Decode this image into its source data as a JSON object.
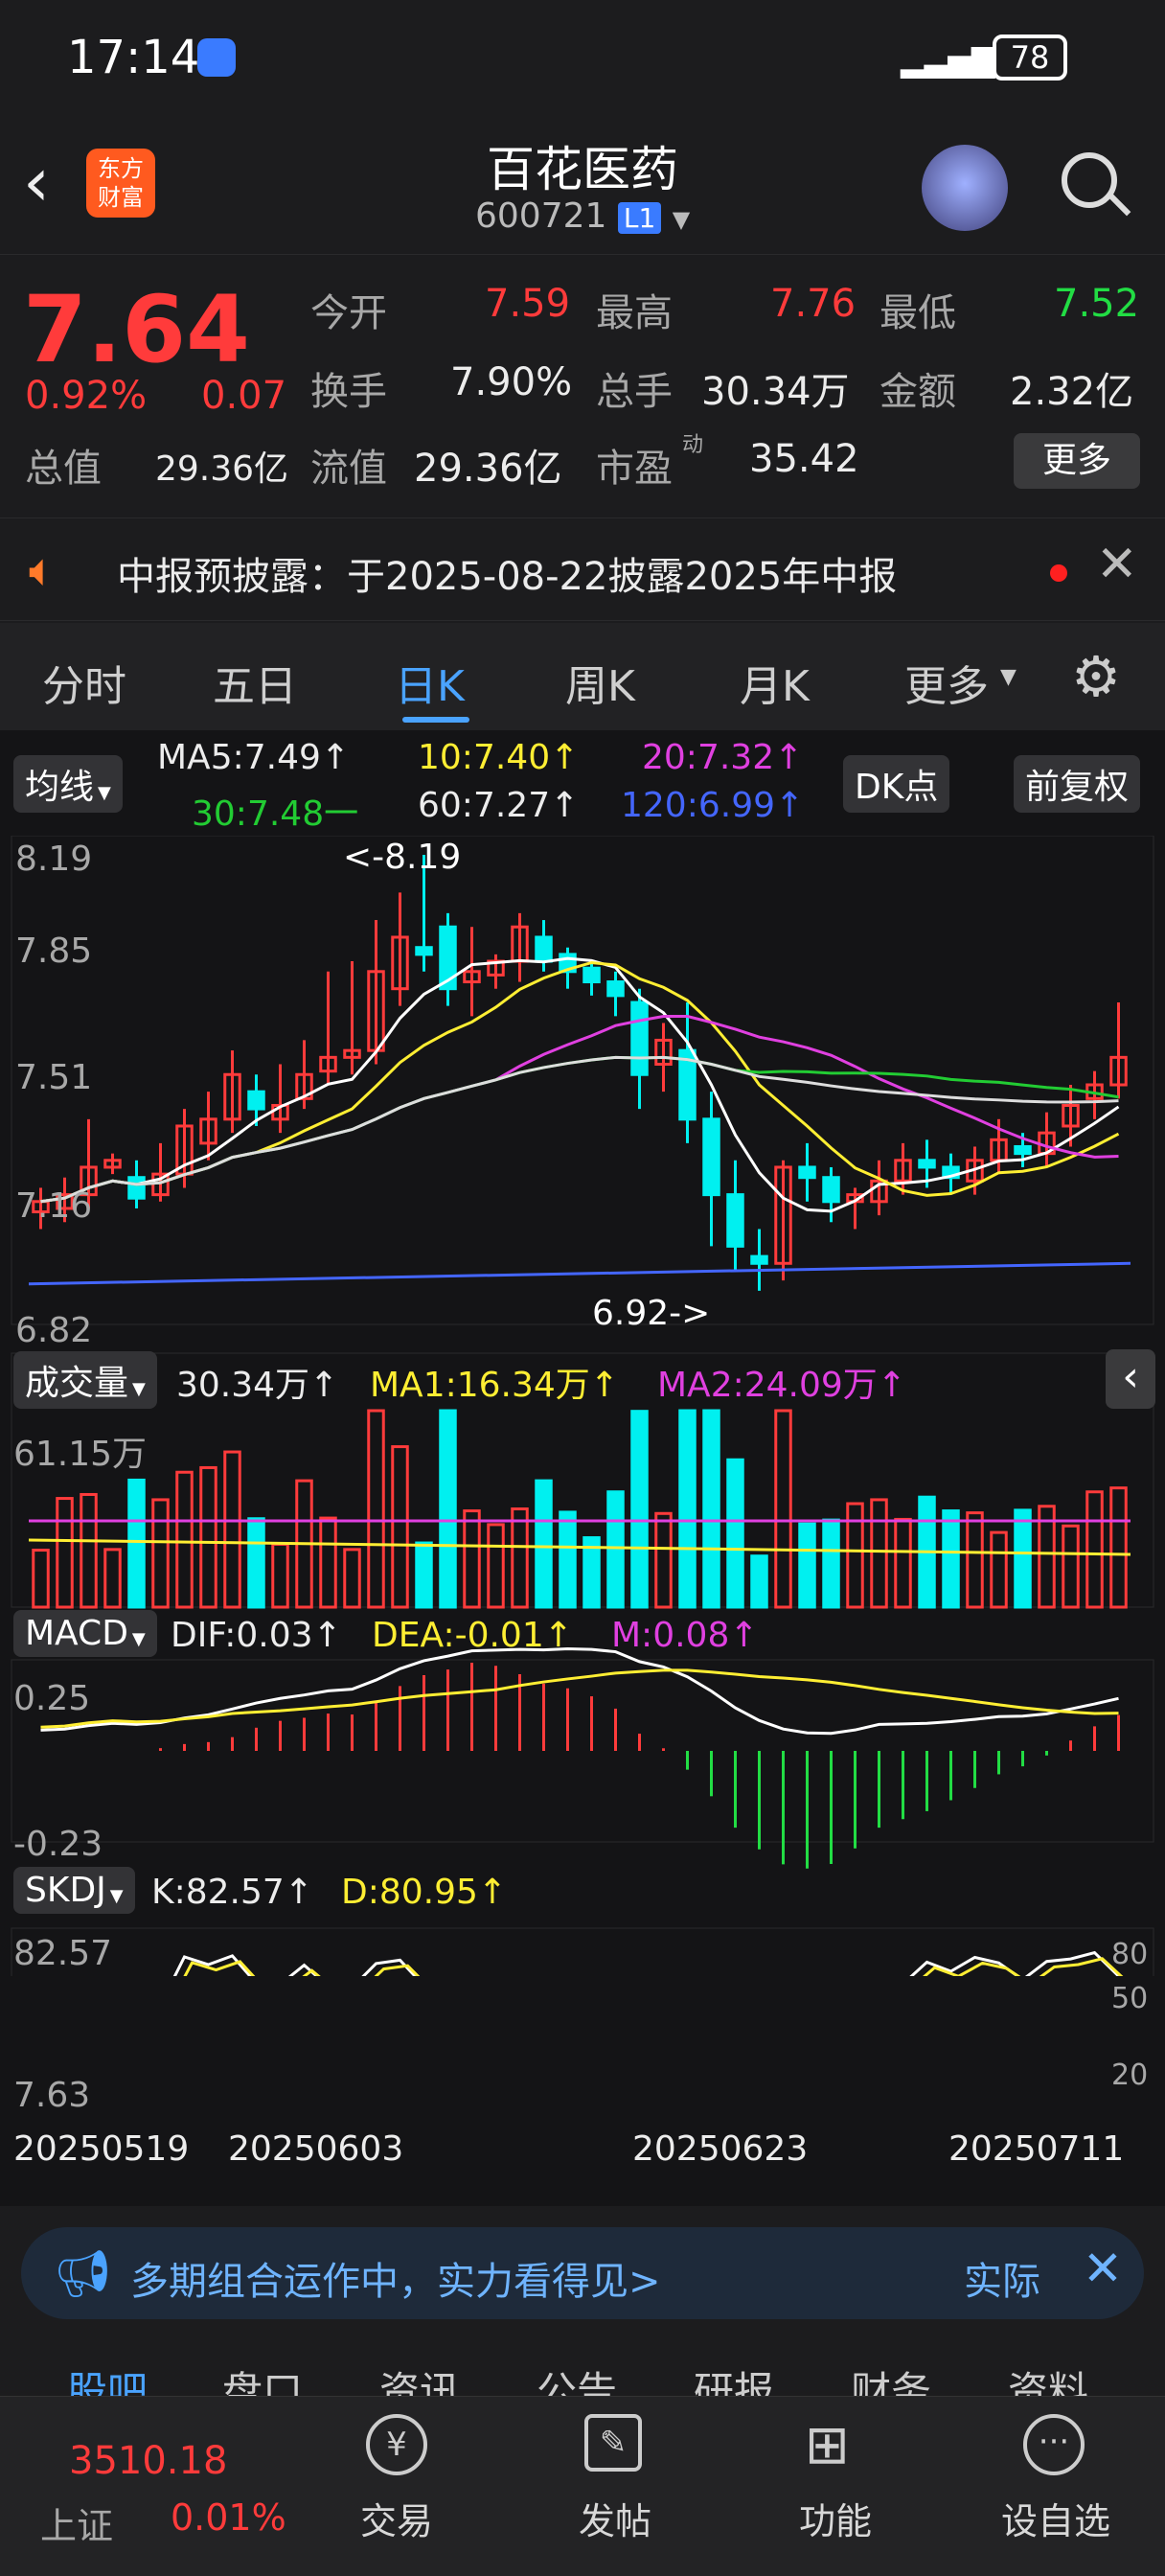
{
  "status": {
    "time": "17:14",
    "battery": "78"
  },
  "header": {
    "title": "百花医药",
    "code": "600721",
    "level": "L1",
    "logo_line1": "东方",
    "logo_line2": "财富"
  },
  "quote": {
    "price": "7.64",
    "pct": "0.92%",
    "chg": "0.07",
    "open_l": "今开",
    "open": "7.59",
    "high_l": "最高",
    "high": "7.76",
    "low_l": "最低",
    "low": "7.52",
    "turn_l": "换手",
    "turn": "7.90%",
    "vol_l": "总手",
    "vol": "30.34万",
    "amt_l": "金额",
    "amt": "2.32亿",
    "mcap_l": "总值",
    "mcap": "29.36亿",
    "flt_l": "流值",
    "flt": "29.36亿",
    "pe_l": "市盈",
    "pe_sup": "动",
    "pe": "35.42",
    "more": "更多"
  },
  "notice": {
    "text": "中报预披露：于2025-08-22披露2025年中报"
  },
  "tabs": [
    "分时",
    "五日",
    "日K",
    "周K",
    "月K",
    "更多"
  ],
  "ma": {
    "sel": "均线",
    "ma5": "MA5:7.49↑",
    "ma10": "10:7.40↑",
    "ma20": "20:7.32↑",
    "ma30": "30:7.48一",
    "ma60": "60:7.27↑",
    "ma120": "120:6.99↑",
    "dk": "DK点",
    "fq": "前复权"
  },
  "chart_data": {
    "type": "candlestick",
    "high_mark": "<-8.19",
    "low_mark": "6.92->",
    "y_max": "8.19",
    "y_2": "7.85",
    "y_3": "7.51",
    "y_4": "7.16",
    "y_min": "6.82",
    "dates": [
      "20250519",
      "20250603",
      "20250623",
      "20250711"
    ],
    "candles": [
      [
        7.15,
        7.18,
        7.1,
        7.22
      ],
      [
        7.16,
        7.2,
        7.12,
        7.25
      ],
      [
        7.2,
        7.28,
        7.16,
        7.42
      ],
      [
        7.28,
        7.3,
        7.26,
        7.32
      ],
      [
        7.25,
        7.19,
        7.16,
        7.3
      ],
      [
        7.2,
        7.26,
        7.18,
        7.35
      ],
      [
        7.26,
        7.4,
        7.22,
        7.45
      ],
      [
        7.35,
        7.42,
        7.3,
        7.5
      ],
      [
        7.42,
        7.55,
        7.38,
        7.62
      ],
      [
        7.5,
        7.45,
        7.4,
        7.55
      ],
      [
        7.42,
        7.46,
        7.38,
        7.58
      ],
      [
        7.48,
        7.55,
        7.45,
        7.65
      ],
      [
        7.56,
        7.6,
        7.52,
        7.85
      ],
      [
        7.6,
        7.62,
        7.55,
        7.88
      ],
      [
        7.62,
        7.85,
        7.58,
        8.0
      ],
      [
        7.8,
        7.95,
        7.75,
        8.08
      ],
      [
        7.92,
        7.9,
        7.85,
        8.19
      ],
      [
        7.98,
        7.8,
        7.75,
        8.02
      ],
      [
        7.82,
        7.85,
        7.72,
        7.98
      ],
      [
        7.84,
        7.88,
        7.8,
        7.9
      ],
      [
        7.88,
        7.98,
        7.82,
        8.02
      ],
      [
        7.95,
        7.88,
        7.85,
        8.0
      ],
      [
        7.9,
        7.85,
        7.8,
        7.92
      ],
      [
        7.86,
        7.82,
        7.78,
        7.88
      ],
      [
        7.82,
        7.78,
        7.72,
        7.85
      ],
      [
        7.76,
        7.55,
        7.45,
        7.8
      ],
      [
        7.58,
        7.65,
        7.5,
        7.7
      ],
      [
        7.62,
        7.42,
        7.35,
        7.76
      ],
      [
        7.42,
        7.2,
        7.05,
        7.5
      ],
      [
        7.2,
        7.05,
        6.98,
        7.3
      ],
      [
        7.02,
        7.0,
        6.92,
        7.1
      ],
      [
        7.0,
        7.28,
        6.95,
        7.3
      ],
      [
        7.28,
        7.25,
        7.18,
        7.35
      ],
      [
        7.25,
        7.18,
        7.12,
        7.28
      ],
      [
        7.18,
        7.2,
        7.1,
        7.22
      ],
      [
        7.18,
        7.24,
        7.14,
        7.3
      ],
      [
        7.24,
        7.3,
        7.2,
        7.35
      ],
      [
        7.3,
        7.28,
        7.22,
        7.36
      ],
      [
        7.28,
        7.25,
        7.2,
        7.32
      ],
      [
        7.24,
        7.3,
        7.2,
        7.34
      ],
      [
        7.3,
        7.36,
        7.26,
        7.42
      ],
      [
        7.34,
        7.32,
        7.28,
        7.38
      ],
      [
        7.32,
        7.38,
        7.28,
        7.44
      ],
      [
        7.4,
        7.46,
        7.34,
        7.52
      ],
      [
        7.48,
        7.52,
        7.42,
        7.56
      ],
      [
        7.52,
        7.6,
        7.48,
        7.76
      ]
    ],
    "vol_label": "61.15万",
    "vol_sel": "成交量",
    "vol": "30.34万↑",
    "vma1": "MA1:16.34万↑",
    "vma2": "MA2:24.09万↑",
    "macd_sel": "MACD",
    "dif": "DIF:0.03↑",
    "dea": "DEA:-0.01↑",
    "m": "M:0.08↑",
    "macd_max": "0.25",
    "macd_min": "-0.23",
    "skdj_sel": "SKDJ",
    "k": "K:82.57↑",
    "d": "D:80.95↑",
    "sk_max": "82.57",
    "sk_min": "7.63",
    "sk80": "80",
    "sk50": "50",
    "sk20": "20"
  },
  "ad": {
    "text": "多期组合运作中，实力看得见>",
    "side": "实际"
  },
  "subtabs": [
    "股吧",
    "盘口",
    "资讯",
    "公告",
    "研报",
    "财务",
    "资料"
  ],
  "bottom": {
    "index": "3510.18",
    "index_name": "上证",
    "index_pct": "0.01%",
    "nav": [
      "交易",
      "发帖",
      "功能",
      "设自选"
    ]
  },
  "colors": {
    "up": "#ff3b3b",
    "down": "#00f0f0",
    "accent": "#4aa3ff"
  }
}
